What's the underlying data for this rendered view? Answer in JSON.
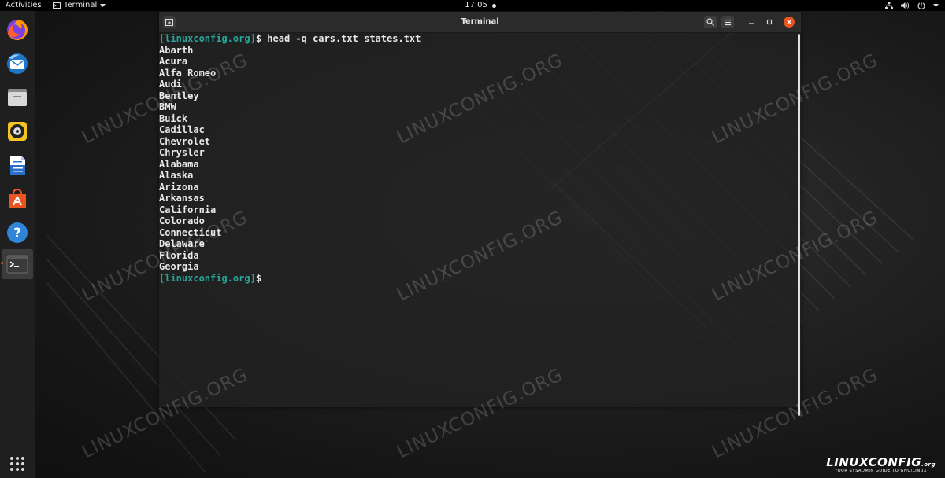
{
  "topbar": {
    "activities": "Activities",
    "app_menu": "Terminal",
    "clock": "17:05",
    "tray_icons": [
      "network-icon",
      "volume-icon",
      "power-icon",
      "chevron-down-icon"
    ]
  },
  "dock": {
    "items": [
      {
        "name": "dock-firefox",
        "icon": "firefox-icon"
      },
      {
        "name": "dock-thunderbird",
        "icon": "thunderbird-icon"
      },
      {
        "name": "dock-files",
        "icon": "files-icon"
      },
      {
        "name": "dock-rhythmbox",
        "icon": "rhythmbox-icon"
      },
      {
        "name": "dock-writer",
        "icon": "writer-icon"
      },
      {
        "name": "dock-software",
        "icon": "software-icon"
      },
      {
        "name": "dock-help",
        "icon": "help-icon"
      },
      {
        "name": "dock-terminal",
        "icon": "terminal-icon"
      }
    ],
    "show_apps_icon": "grid-icon"
  },
  "terminal": {
    "title": "Terminal",
    "prompt": "[linuxconfig.org]",
    "command": "$ head -q cars.txt states.txt",
    "output": [
      "Abarth",
      "Acura",
      "Alfa Romeo",
      "Audi",
      "Bentley",
      "BMW",
      "Buick",
      "Cadillac",
      "Chevrolet",
      "Chrysler",
      "Alabama",
      "Alaska",
      "Arizona",
      "Arkansas",
      "California",
      "Colorado",
      "Connecticut",
      "Delaware",
      "Florida",
      "Georgia"
    ],
    "final_prompt": "[linuxconfig.org]",
    "final_suffix": "$",
    "prompt_color": "#26a69a"
  },
  "watermark": {
    "text": "LINUXCONFIG.ORG"
  },
  "logo": {
    "name": "LINUXCONFIG",
    "suffix": ".org",
    "tagline": "YOUR SYSADMIN GUIDE TO GNU/LINUX"
  },
  "colors": {
    "accent": "#e95420",
    "dock_bg": "#1f1f1f",
    "topbar_bg": "#000000"
  }
}
